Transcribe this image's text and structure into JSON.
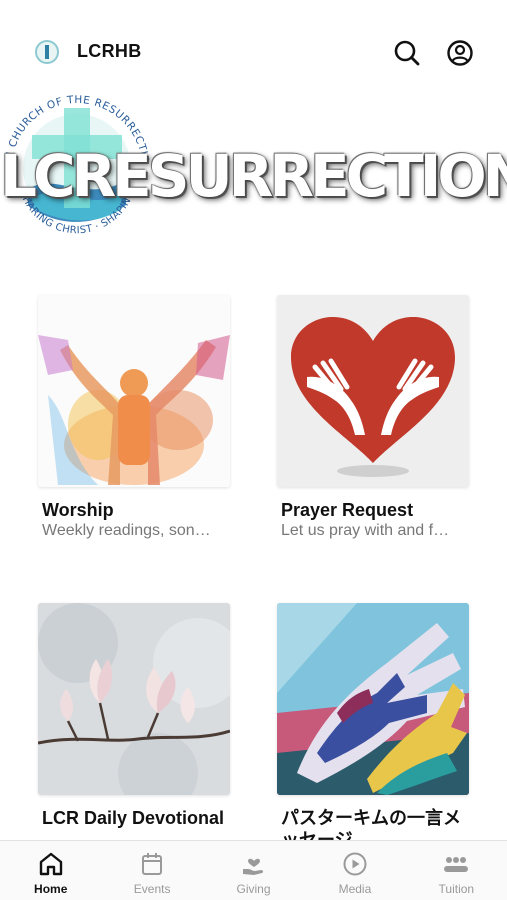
{
  "header": {
    "title": "LCRHB",
    "logo_icon": "church-logo-icon",
    "search_icon": "search-icon",
    "profile_icon": "user-circle-icon"
  },
  "banner": {
    "logo_ring_text": "AN CHURCH OF THE RESURRECTION · SHARING CHRIST · SHAPING LIVES",
    "headline": "LCRESURRECTION"
  },
  "cards": [
    {
      "title": "Worship",
      "subtitle": "Weekly readings, son…"
    },
    {
      "title": "Prayer Request",
      "subtitle": "Let us pray with and f…"
    },
    {
      "title": "LCR Daily Devotional",
      "subtitle": ""
    },
    {
      "title": "パスターキムの一言メッセージ",
      "subtitle": ""
    }
  ],
  "tabbar": {
    "items": [
      {
        "label": "Home",
        "icon": "home-icon",
        "active": true
      },
      {
        "label": "Events",
        "icon": "calendar-icon",
        "active": false
      },
      {
        "label": "Giving",
        "icon": "giving-hand-icon",
        "active": false
      },
      {
        "label": "Media",
        "icon": "play-circle-icon",
        "active": false
      },
      {
        "label": "Tuition",
        "icon": "group-icon",
        "active": false
      }
    ]
  },
  "colors": {
    "accent": "#111111",
    "inactive": "#9a9a9a",
    "heart_red": "#c0392b",
    "teal": "#5fd3c4"
  }
}
